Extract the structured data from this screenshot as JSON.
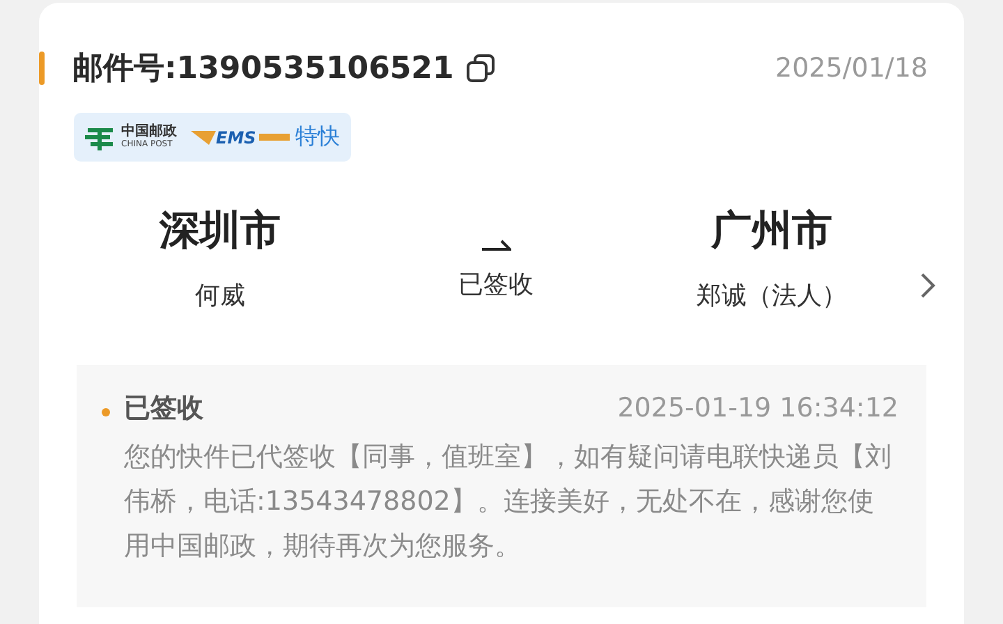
{
  "header": {
    "label": "邮件号:1390535106521",
    "date": "2025/01/18"
  },
  "service_badge": {
    "brand_cn": "中国邮政",
    "brand_en": "CHINA POST",
    "ems": "EMS",
    "service": "特快"
  },
  "route": {
    "origin": {
      "city": "深圳市",
      "person": "何威"
    },
    "status": "已签收",
    "destination": {
      "city": "广州市",
      "person": "郑诚（法人）"
    }
  },
  "tracking": {
    "status": "已签收",
    "time": "2025-01-19 16:34:12",
    "description": "您的快件已代签收【同事，值班室】，如有疑问请电联快递员【刘伟桥，电话:13543478802】。连接美好，无处不在，感谢您使用中国邮政，期待再次为您服务。"
  }
}
